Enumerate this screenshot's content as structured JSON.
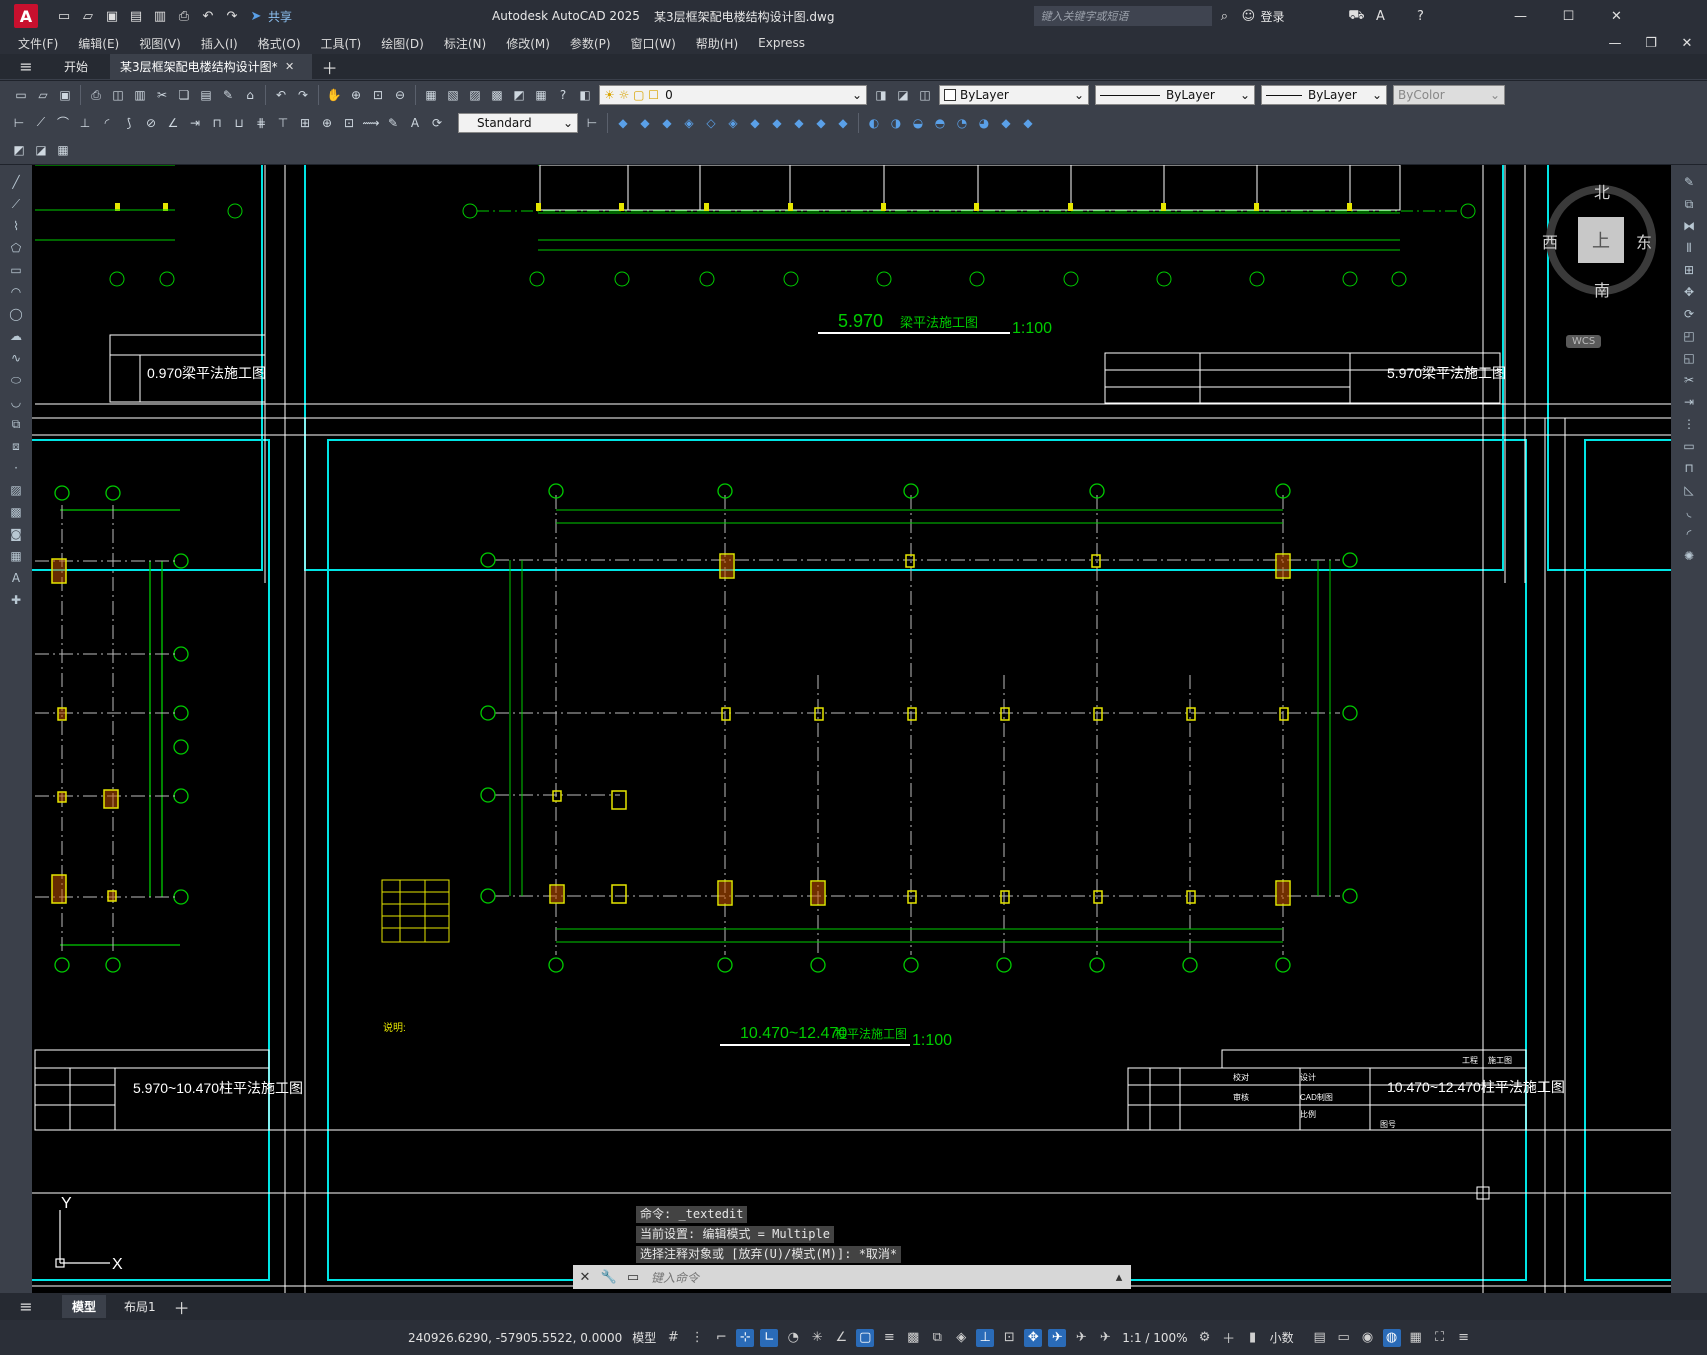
{
  "titlebar": {
    "logo": "A",
    "share": "共享",
    "app_title": "Autodesk AutoCAD 2025",
    "file_title": "某3层框架配电楼结构设计图.dwg",
    "search_placeholder": "键入关键字或短语",
    "login": "登录"
  },
  "menu": [
    "文件(F)",
    "编辑(E)",
    "视图(V)",
    "插入(I)",
    "格式(O)",
    "工具(T)",
    "绘图(D)",
    "标注(N)",
    "修改(M)",
    "参数(P)",
    "窗口(W)",
    "帮助(H)",
    "Express"
  ],
  "tabs": {
    "start": "开始",
    "active": "某3层框架配电楼结构设计图*"
  },
  "toolbar": {
    "layer_value": "0",
    "color": "ByLayer",
    "linetype": "ByLayer",
    "lineweight": "ByLayer",
    "plotstyle": "ByColor",
    "textstyle": "Standard"
  },
  "viewcube": {
    "north": "北",
    "south": "南",
    "east": "东",
    "west": "西",
    "top": "上",
    "wcs": "WCS"
  },
  "drawing": {
    "sheet_top_center_title": "5.970",
    "sheet_top_center_subtitle": "梁平法施工图",
    "sheet_top_center_scale": "1:100",
    "sheet_left_top_title": "0.970梁平法施工图",
    "sheet_right_top_title": "5.970梁平法施工图",
    "sheet_main_title": "10.470~12.470",
    "sheet_main_subtitle": "柱平法施工图",
    "sheet_main_scale": "1:100",
    "sheet_left_bottom_title": "5.970~10.470柱平法施工图",
    "sheet_right_bottom_title": "10.470~12.470柱平法施工图",
    "notes_label": "说明:",
    "axis_y": "Y",
    "axis_x": "X",
    "tb_labels": [
      "设计",
      "CAD制图",
      "比例",
      "图号",
      "工程",
      "施工图",
      "审核",
      "校对"
    ]
  },
  "command": {
    "history": [
      "命令: _textedit",
      "当前设置: 编辑模式 = Multiple",
      "选择注释对象或 [放弃(U)/模式(M)]: *取消*"
    ],
    "placeholder": "键入命令"
  },
  "layouts": [
    "模型",
    "布局1"
  ],
  "status": {
    "coords": "240926.6290, -57905.5522, 0.0000",
    "model": "模型",
    "scale": "1:1 / 100%",
    "units": "小数"
  }
}
